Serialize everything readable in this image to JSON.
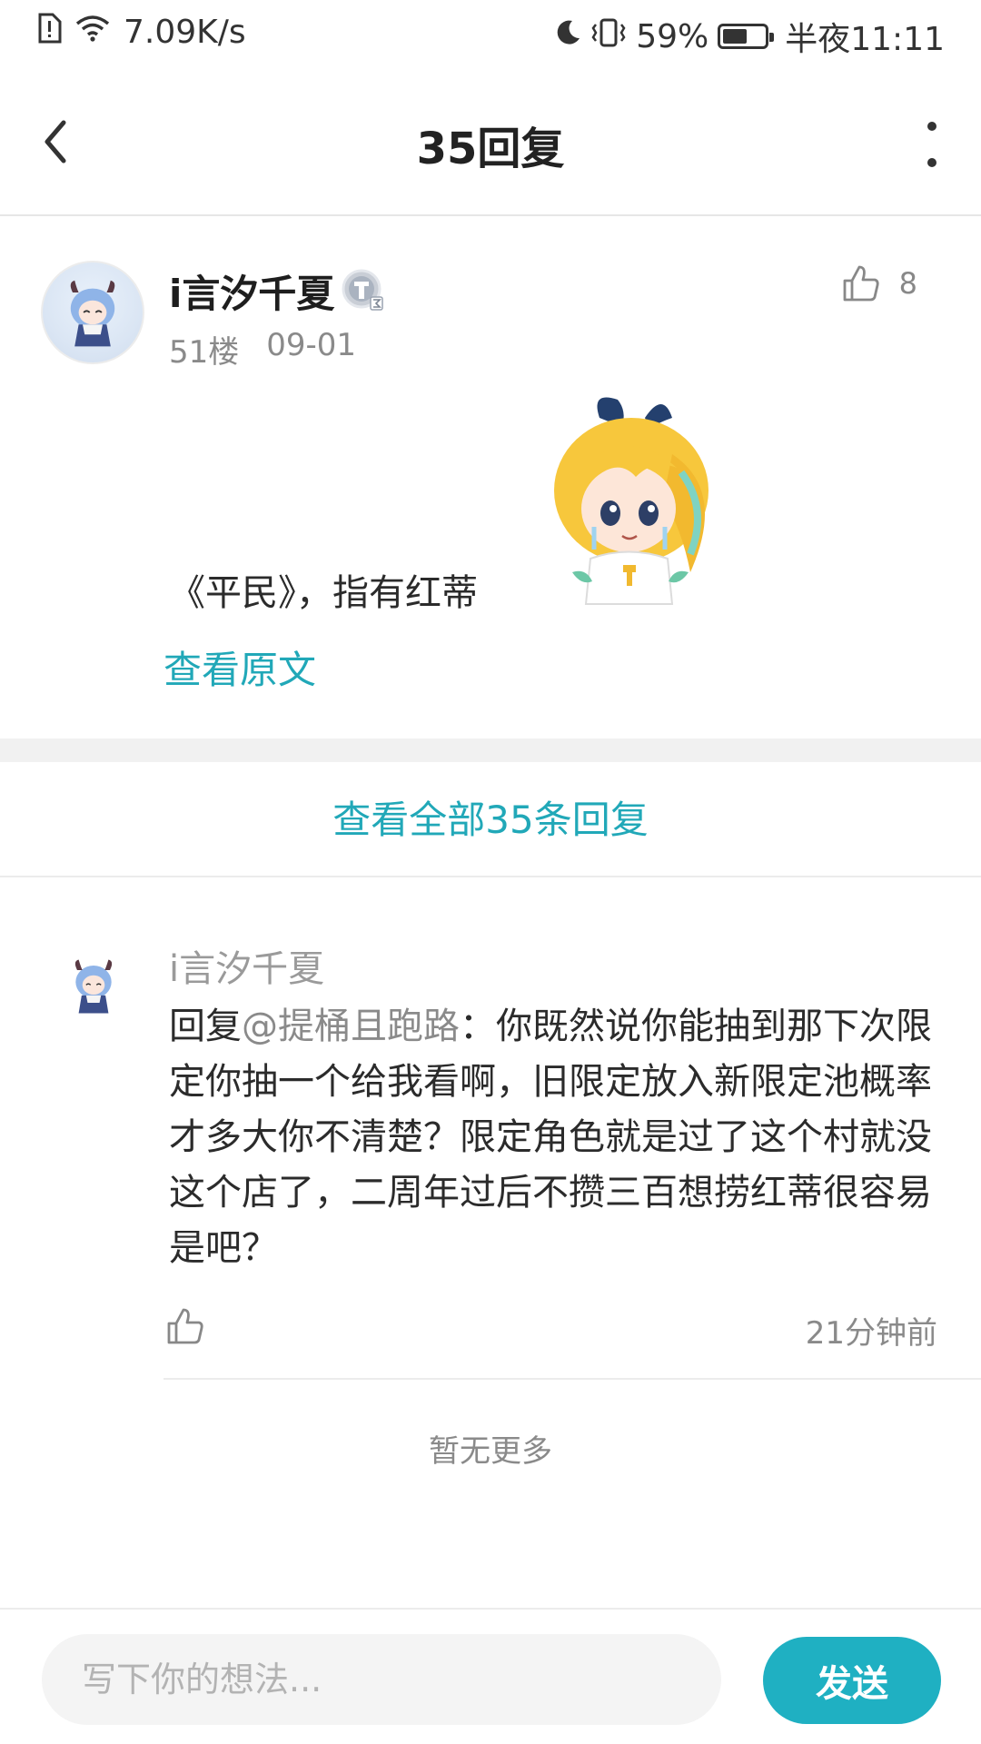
{
  "status_bar": {
    "network_speed": "7.09K/s",
    "battery_percent": "59%",
    "battery_level": 0.59,
    "time": "半夜11:11",
    "icons": [
      "sim-alert-icon",
      "wifi-icon",
      "moon-icon",
      "vibrate-icon",
      "battery-icon"
    ]
  },
  "header": {
    "title": "35回复",
    "back_icon": "chevron-left-icon",
    "more_icon": "more-vertical-icon"
  },
  "post": {
    "username": "i言汐千夏",
    "badge_icon": "level-badge-icon",
    "floor": "51楼",
    "date": "09-01",
    "like_count": "8",
    "text": "《平民》，指有红蒂",
    "view_original": "查看原文"
  },
  "view_all_label": "查看全部35条回复",
  "reply": {
    "username": "i言汐千夏",
    "reply_prefix": "回复",
    "mention": "@提桶且跑路",
    "colon": "：",
    "text": "你既然说你能抽到那下次限定你抽一个给我看啊，旧限定放入新限定池概率才多大你不清楚？限定角色就是过了这个村就没这个店了，二周年过后不攒三百想捞红蒂很容易是吧？",
    "time": "21分钟前"
  },
  "no_more": "暂无更多",
  "bottom_bar": {
    "input_placeholder": "写下你的想法...",
    "send_label": "发送"
  },
  "colors": {
    "accent": "#21a8b8",
    "send_button": "#1fb0c2"
  }
}
